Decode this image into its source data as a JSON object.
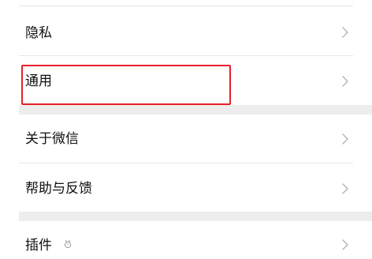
{
  "settings": {
    "items": [
      {
        "label": "隐私"
      },
      {
        "label": "通用"
      },
      {
        "label": "关于微信"
      },
      {
        "label": "帮助与反馈"
      },
      {
        "label": "插件"
      }
    ]
  },
  "icons": {
    "chevron": "chevron-right-icon",
    "plugin_badge": "plugin-badge-icon"
  },
  "colors": {
    "highlight": "#e8202a",
    "section_gap": "#ededed",
    "chevron": "#b2b2b2"
  }
}
